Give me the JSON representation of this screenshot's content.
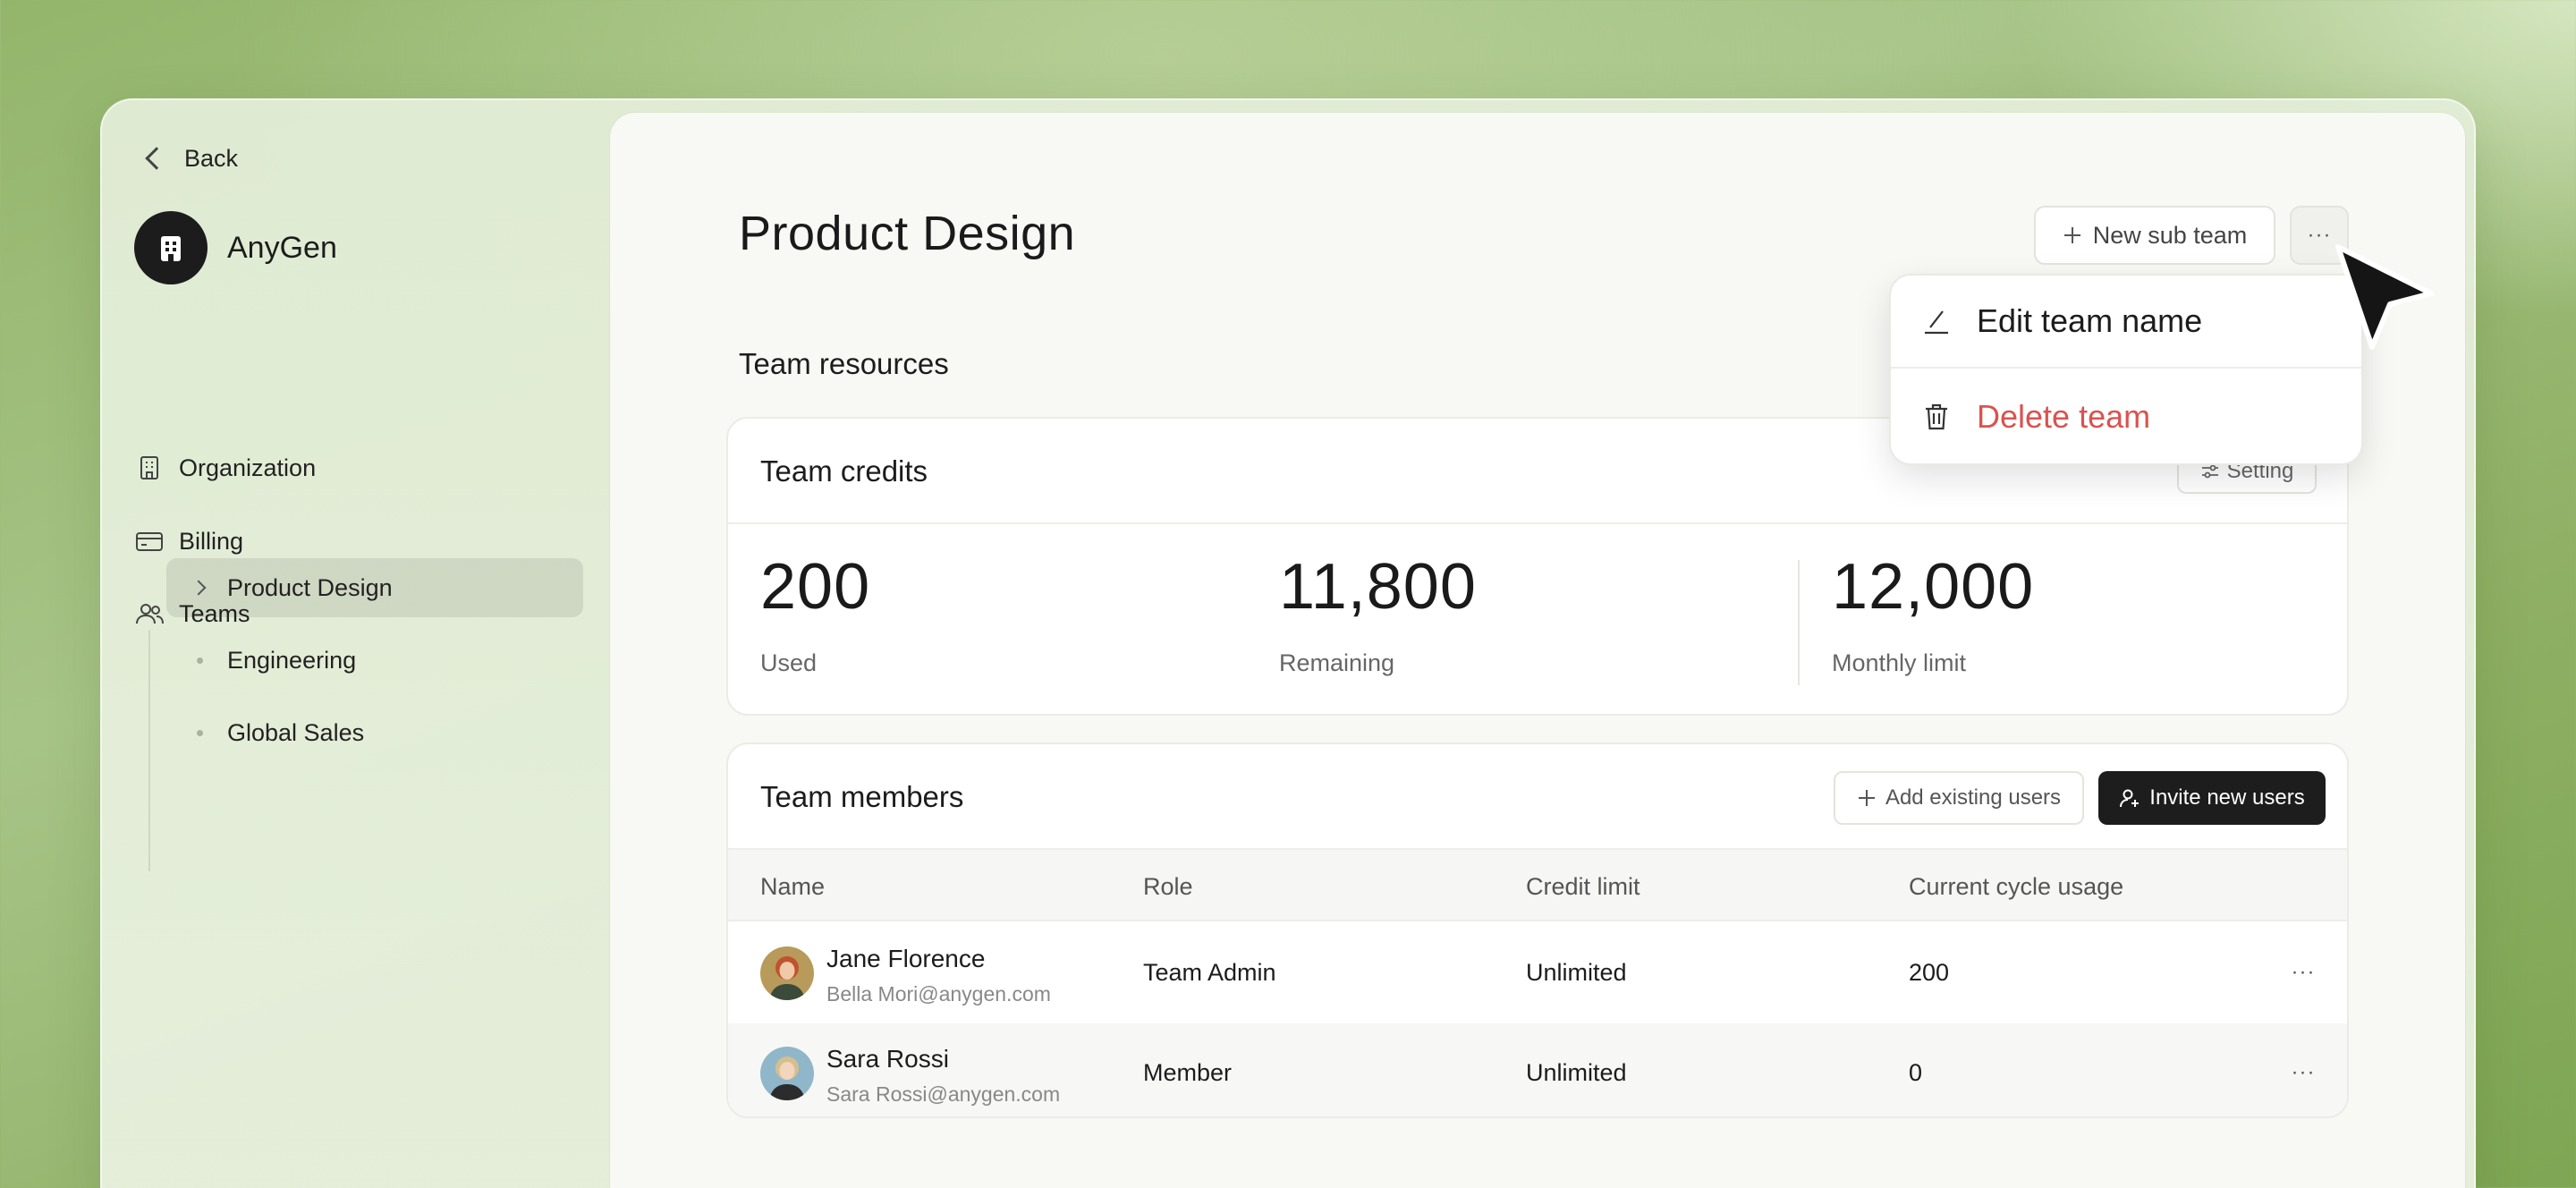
{
  "sidebar": {
    "back_label": "Back",
    "org_name": "AnyGen",
    "nav": [
      {
        "label": "Organization",
        "icon": "building-icon"
      },
      {
        "label": "Billing",
        "icon": "credit-card-icon"
      },
      {
        "label": "Teams",
        "icon": "users-icon"
      }
    ],
    "teams": [
      {
        "label": "Product Design",
        "active": true
      },
      {
        "label": "Engineering",
        "active": false
      },
      {
        "label": "Global Sales",
        "active": false
      }
    ]
  },
  "header": {
    "title": "Product Design",
    "new_sub_team_label": "New sub team",
    "more_label": "···"
  },
  "menu": {
    "edit_label": "Edit team name",
    "delete_label": "Delete team"
  },
  "resources": {
    "section_title": "Team resources",
    "credits": {
      "title": "Team credits",
      "setting_label": "Setting",
      "used_value": "200",
      "used_label": "Used",
      "remaining_value": "11,800",
      "remaining_label": "Remaining",
      "limit_value": "12,000",
      "limit_label": "Monthly limit"
    }
  },
  "members": {
    "title": "Team members",
    "add_existing_label": "Add existing users",
    "invite_label": "Invite new users",
    "columns": [
      "Name",
      "Role",
      "Credit limit",
      "Current cycle usage"
    ],
    "rows": [
      {
        "name": "Jane Florence",
        "email": "Bella Mori@anygen.com",
        "role": "Team Admin",
        "credit_limit": "Unlimited",
        "usage": "200",
        "more": "···"
      },
      {
        "name": "Sara Rossi",
        "email": "Sara Rossi@anygen.com",
        "role": "Member",
        "credit_limit": "Unlimited",
        "usage": "0",
        "more": "···"
      }
    ]
  },
  "colors": {
    "accent_dark": "#1d1d1d",
    "danger": "#d9534f",
    "background_green": "#93b56b"
  }
}
